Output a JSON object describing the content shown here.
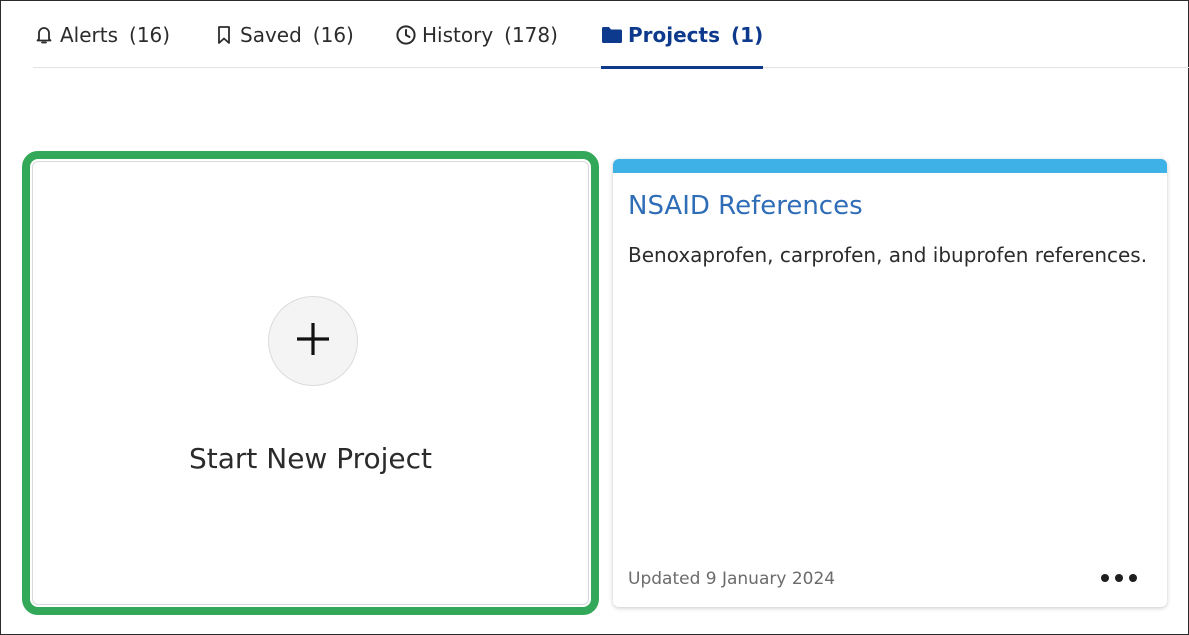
{
  "tabs": [
    {
      "label": "Alerts",
      "count": "(16)",
      "icon": "bell-icon"
    },
    {
      "label": "Saved",
      "count": "(16)",
      "icon": "bookmark-icon"
    },
    {
      "label": "History",
      "count": "(178)",
      "icon": "clock-icon"
    },
    {
      "label": "Projects",
      "count": "(1)",
      "icon": "folder-icon",
      "active": true
    }
  ],
  "new_project": {
    "label": "Start New Project",
    "icon": "plus-icon"
  },
  "projects": [
    {
      "title": "NSAID References",
      "description": "Benoxaprofen, carprofen, and ibuprofen references.",
      "updated": "Updated 9 January 2024",
      "menu_icon": "more-options-icon"
    }
  ],
  "colors": {
    "active_tab": "#0d3a8c",
    "highlight_border": "#34a859",
    "card_topbar": "#3eb1e6",
    "project_title": "#2f6db7"
  }
}
